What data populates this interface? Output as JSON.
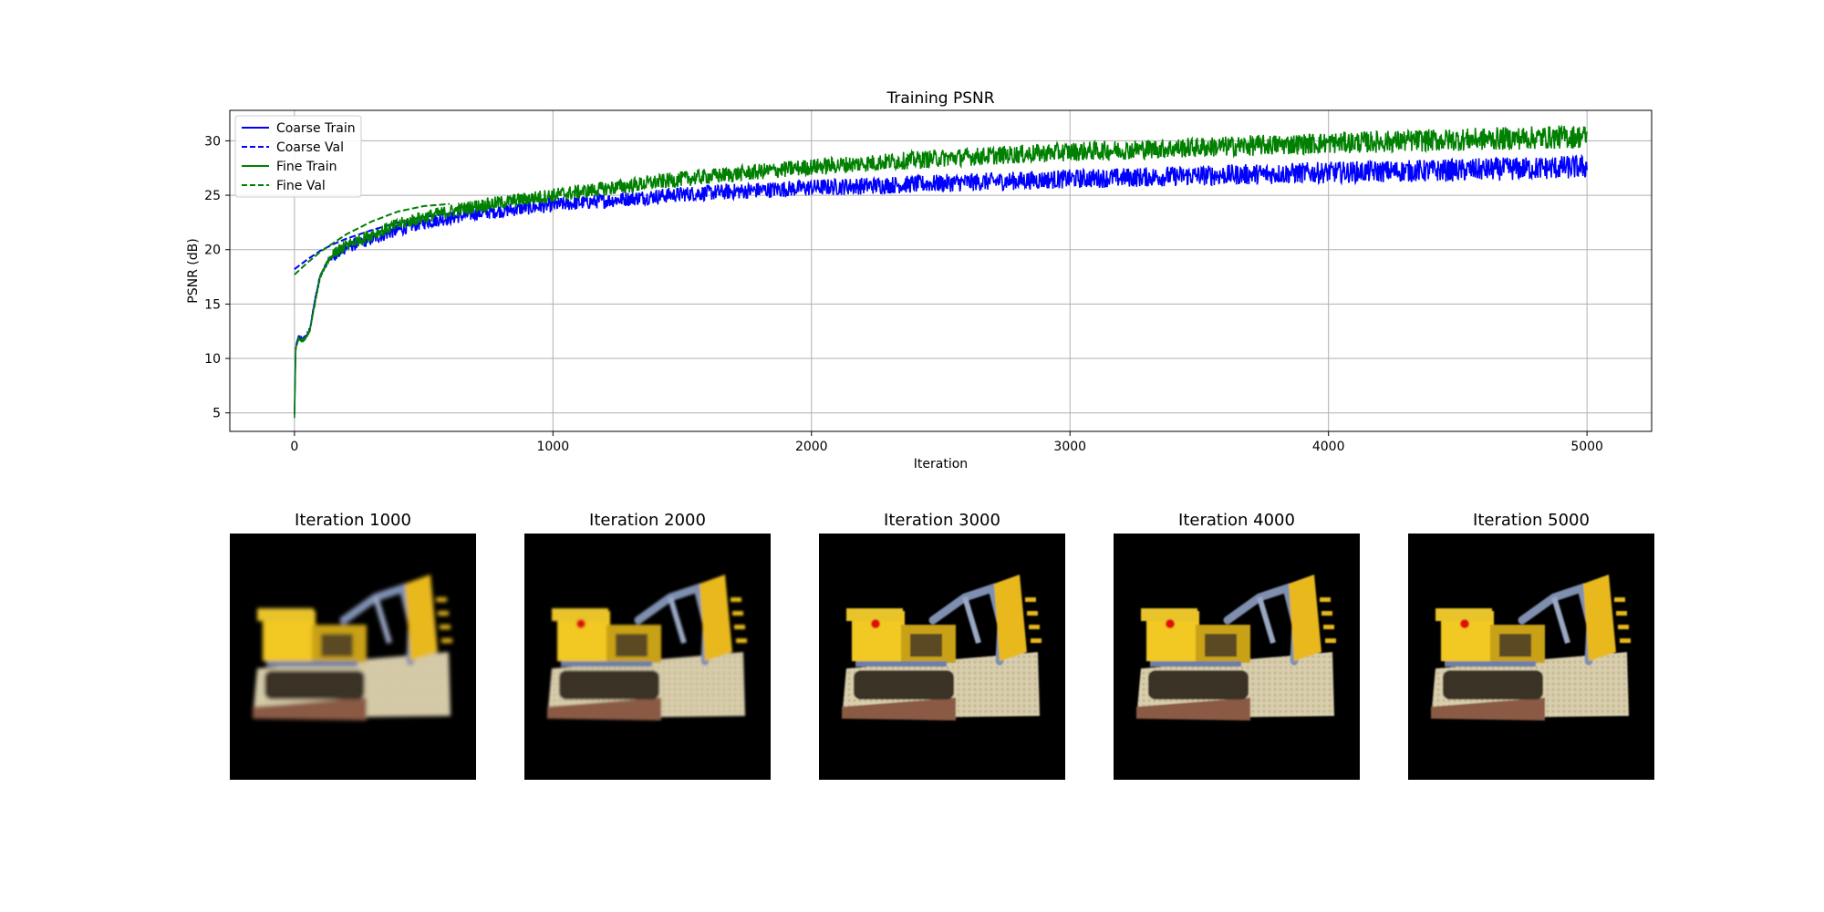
{
  "chart_data": [
    {
      "type": "line",
      "title": "Training PSNR",
      "xlabel": "Iteration",
      "ylabel": "PSNR (dB)",
      "xlim": [
        -250,
        5250
      ],
      "ylim": [
        3.3,
        32.8
      ],
      "xticks": [
        0,
        1000,
        2000,
        3000,
        4000,
        5000
      ],
      "yticks": [
        5,
        10,
        15,
        20,
        25,
        30
      ],
      "grid": true,
      "legend_position": "top-left",
      "series": [
        {
          "name": "Coarse Train",
          "color": "#0000ff",
          "style": "solid",
          "noise": 0.55,
          "x": [
            0,
            5,
            15,
            30,
            45,
            60,
            80,
            100,
            130,
            160,
            200,
            300,
            400,
            500,
            700,
            1000,
            1500,
            2000,
            2500,
            3000,
            3500,
            4000,
            4500,
            5000
          ],
          "y": [
            4.8,
            11.0,
            12.0,
            11.8,
            12.0,
            12.8,
            15.5,
            17.6,
            19.0,
            19.6,
            20.2,
            21.0,
            21.8,
            22.5,
            23.3,
            24.1,
            25.1,
            25.7,
            26.1,
            26.5,
            26.8,
            27.1,
            27.3,
            27.6
          ]
        },
        {
          "name": "Coarse Val",
          "color": "#0000ff",
          "style": "dashed",
          "x": [
            0,
            50,
            100,
            150,
            200,
            300,
            400,
            500,
            600
          ],
          "y": [
            18.2,
            19.1,
            19.9,
            20.5,
            21.0,
            21.8,
            22.5,
            23.0,
            23.3
          ]
        },
        {
          "name": "Fine Train",
          "color": "#008000",
          "style": "solid",
          "noise": 0.55,
          "x": [
            0,
            5,
            15,
            30,
            45,
            60,
            80,
            100,
            130,
            160,
            200,
            300,
            400,
            500,
            700,
            1000,
            1500,
            2000,
            2500,
            3000,
            3500,
            4000,
            4500,
            5000
          ],
          "y": [
            4.6,
            10.8,
            11.8,
            11.6,
            11.9,
            12.6,
            15.2,
            17.5,
            19.0,
            19.7,
            20.4,
            21.4,
            22.3,
            23.0,
            24.0,
            25.0,
            26.5,
            27.6,
            28.4,
            29.0,
            29.4,
            29.8,
            30.1,
            30.4
          ]
        },
        {
          "name": "Fine Val",
          "color": "#008000",
          "style": "dashed",
          "x": [
            0,
            50,
            100,
            150,
            200,
            300,
            400,
            500,
            600
          ],
          "y": [
            17.7,
            18.8,
            19.8,
            20.6,
            21.4,
            22.6,
            23.5,
            24.0,
            24.2
          ]
        }
      ]
    }
  ],
  "renders": [
    {
      "title": "Iteration 1000",
      "blur": 2.2,
      "red_dot": false
    },
    {
      "title": "Iteration 2000",
      "blur": 1.2,
      "red_dot": true
    },
    {
      "title": "Iteration 3000",
      "blur": 0.9,
      "red_dot": true
    },
    {
      "title": "Iteration 4000",
      "blur": 0.8,
      "red_dot": true
    },
    {
      "title": "Iteration 5000",
      "blur": 0.7,
      "red_dot": true
    }
  ]
}
